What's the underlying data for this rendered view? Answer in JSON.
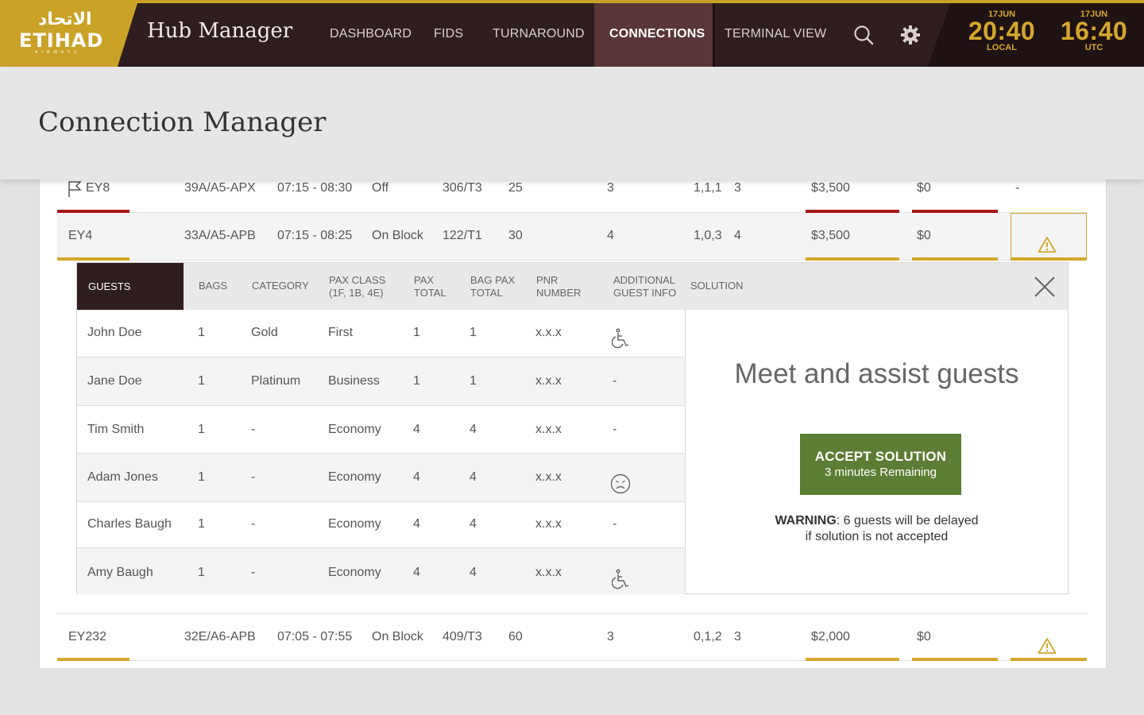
{
  "brand": {
    "arabic": "الاتحاد",
    "english": "ETIHAD",
    "tagline": "AIRWAYS"
  },
  "app_title": "Hub Manager",
  "nav": [
    {
      "label": "DASHBOARD"
    },
    {
      "label": "FIDS"
    },
    {
      "label": "TURNAROUND"
    },
    {
      "label": "CONNECTIONS",
      "active": true
    },
    {
      "label": "TERMINAL VIEW"
    }
  ],
  "icons": {
    "search": "search-icon",
    "settings": "gear-icon"
  },
  "clocks": [
    {
      "date": "17JUN",
      "time": "20:40",
      "zone": "LOCAL"
    },
    {
      "date": "17JUN",
      "time": "16:40",
      "zone": "UTC"
    }
  ],
  "page_title": "Connection Manager",
  "flights": [
    {
      "flight": "EY8",
      "stand": "39A/A5-APX",
      "time": "07:15 - 08:30",
      "status": "Off",
      "gate": "306/T3",
      "pax": "25",
      "conn": "3",
      "class": "1,1,1",
      "count": "3",
      "cost1": "$3,500",
      "cost2": "$0",
      "action": "-",
      "flag": true,
      "bar_color": "#a6191d"
    },
    {
      "flight": "EY4",
      "stand": "33A/A5-APB",
      "time": "07:15 - 08:25",
      "status": "On Block",
      "gate": "122/T1",
      "pax": "30",
      "conn": "4",
      "class": "1,0,3",
      "count": "4",
      "cost1": "$3,500",
      "cost2": "$0",
      "action": "warning",
      "bar_color": "#d4a72c"
    },
    {
      "flight": "EY232",
      "stand": "32E/A6-APB",
      "time": "07:05 - 07:55",
      "status": "On Block",
      "gate": "409/T3",
      "pax": "60",
      "conn": "3",
      "class": "0,1,2",
      "count": "3",
      "cost1": "$2,000",
      "cost2": "$0",
      "action": "warning",
      "bar_color": "#d4a72c"
    }
  ],
  "detail": {
    "headers": {
      "guests": "GUESTS",
      "bags": "BAGS",
      "category": "CATEGORY",
      "pax_class_1": "PAX CLASS",
      "pax_class_2": "(1F, 1B, 4E)",
      "pax_total_1": "PAX",
      "pax_total_2": "TOTAL",
      "bag_pax_1": "BAG PAX",
      "bag_pax_2": "TOTAL",
      "pnr_1": "PNR",
      "pnr_2": "NUMBER",
      "addl_1": "ADDITIONAL",
      "addl_2": "GUEST INFO",
      "solution": "SOLUTION"
    },
    "guests": [
      {
        "name": "John Doe",
        "bags": "1",
        "category": "Gold",
        "pax_class": "First",
        "pax_total": "1",
        "bag_pax_total": "1",
        "pnr": "x.x.x",
        "info": "wheelchair-icon"
      },
      {
        "name": "Jane Doe",
        "bags": "1",
        "category": "Platinum",
        "pax_class": "Business",
        "pax_total": "1",
        "bag_pax_total": "1",
        "pnr": "x.x.x",
        "info": "-"
      },
      {
        "name": "Tim Smith",
        "bags": "1",
        "category": "-",
        "pax_class": "Economy",
        "pax_total": "4",
        "bag_pax_total": "4",
        "pnr": "x.x.x",
        "info": "-"
      },
      {
        "name": "Adam Jones",
        "bags": "1",
        "category": "-",
        "pax_class": "Economy",
        "pax_total": "4",
        "bag_pax_total": "4",
        "pnr": "x.x.x",
        "info": "sad-face-icon"
      },
      {
        "name": "Charles Baugh",
        "bags": "1",
        "category": "-",
        "pax_class": "Economy",
        "pax_total": "4",
        "bag_pax_total": "4",
        "pnr": "x.x.x",
        "info": "-"
      },
      {
        "name": "Amy Baugh",
        "bags": "1",
        "category": "-",
        "pax_class": "Economy",
        "pax_total": "4",
        "bag_pax_total": "4",
        "pnr": "x.x.x",
        "info": "wheelchair-icon"
      }
    ],
    "solution": {
      "title": "Meet and assist guests",
      "accept_label": "ACCEPT SOLUTION",
      "accept_sub": "3 minutes Remaining",
      "warning_label": "WARNING",
      "warning_text": ": 6 guests will be delayed",
      "warning_text2": "if solution is not accepted"
    }
  },
  "colors": {
    "brand_gold": "#c9a227",
    "topbar": "#2f1e1f",
    "accent_red": "#a6191d",
    "accept_green": "#5c7d33"
  }
}
